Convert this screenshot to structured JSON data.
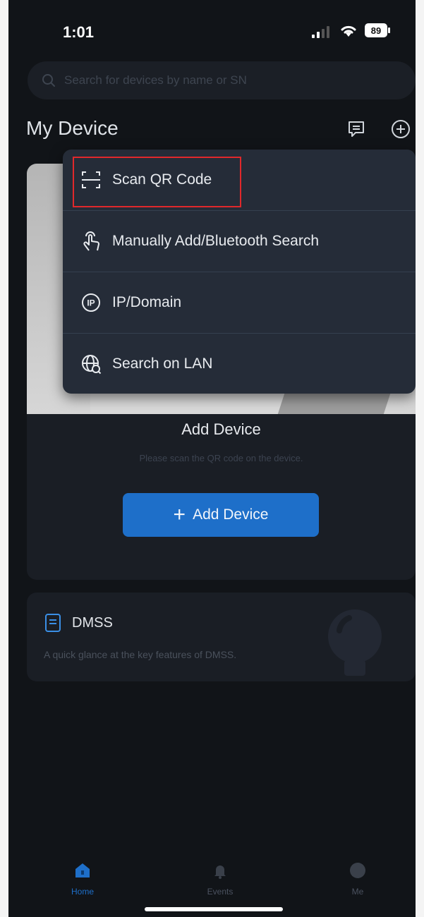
{
  "status_bar": {
    "time": "1:01",
    "battery": "89"
  },
  "search": {
    "placeholder": "Search for devices by name or SN",
    "icon": "search-icon"
  },
  "header": {
    "title": "My Device",
    "icons": [
      "message-icon",
      "plus-circle-icon"
    ]
  },
  "menu": {
    "items": [
      {
        "label": "Scan QR Code",
        "icon": "scan-icon",
        "highlighted": true
      },
      {
        "label": "Manually Add/Bluetooth Search",
        "icon": "hand-touch-icon"
      },
      {
        "label": "IP/Domain",
        "icon": "ip-icon"
      },
      {
        "label": "Search on LAN",
        "icon": "globe-search-icon"
      }
    ],
    "highlight_color": "#e0282b"
  },
  "device_card": {
    "title": "Add Device",
    "subtitle": "Please scan the QR code on the device.",
    "button_label": "Add Device",
    "button_color": "#1e6fc9"
  },
  "dmss_card": {
    "title": "DMSS",
    "subtitle": "A quick glance at the key features of DMSS."
  },
  "tabbar": {
    "tabs": [
      {
        "label": "Home",
        "icon": "home-icon",
        "active": true
      },
      {
        "label": "Events",
        "icon": "bell-icon",
        "active": false
      },
      {
        "label": "Me",
        "icon": "profile-icon",
        "active": false
      }
    ],
    "accent": "#1e6fc9"
  }
}
